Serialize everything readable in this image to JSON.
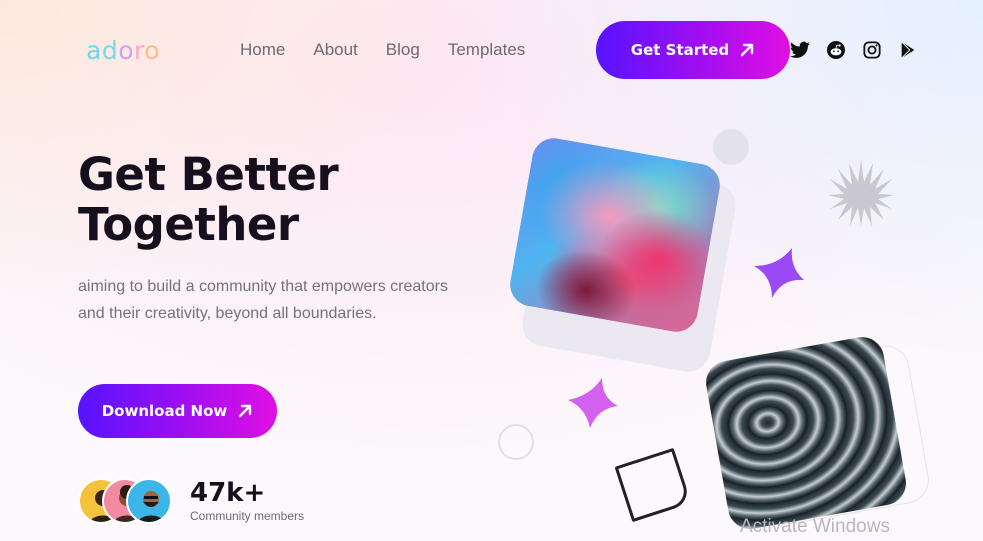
{
  "logo": {
    "letters": [
      "a",
      "d",
      "o",
      "r",
      "o"
    ]
  },
  "nav": {
    "items": [
      {
        "label": "Home"
      },
      {
        "label": "About"
      },
      {
        "label": "Blog"
      },
      {
        "label": "Templates"
      }
    ],
    "cta_label": "Get Started"
  },
  "socials": [
    "twitter-icon",
    "reddit-icon",
    "instagram-icon",
    "play-store-icon"
  ],
  "hero": {
    "title_line1": "Get Better",
    "title_line2": "Together",
    "subtitle": "aiming to build a community that empowers creators and their creativity, beyond all boundaries.",
    "cta_label": "Download Now"
  },
  "stats": {
    "value": "47k+",
    "label": "Community members"
  },
  "colors": {
    "accent_start": "#5713ff",
    "accent_end": "#e10ee4",
    "sparkle": "#9b48f5"
  },
  "watermark": "Activate Windows"
}
